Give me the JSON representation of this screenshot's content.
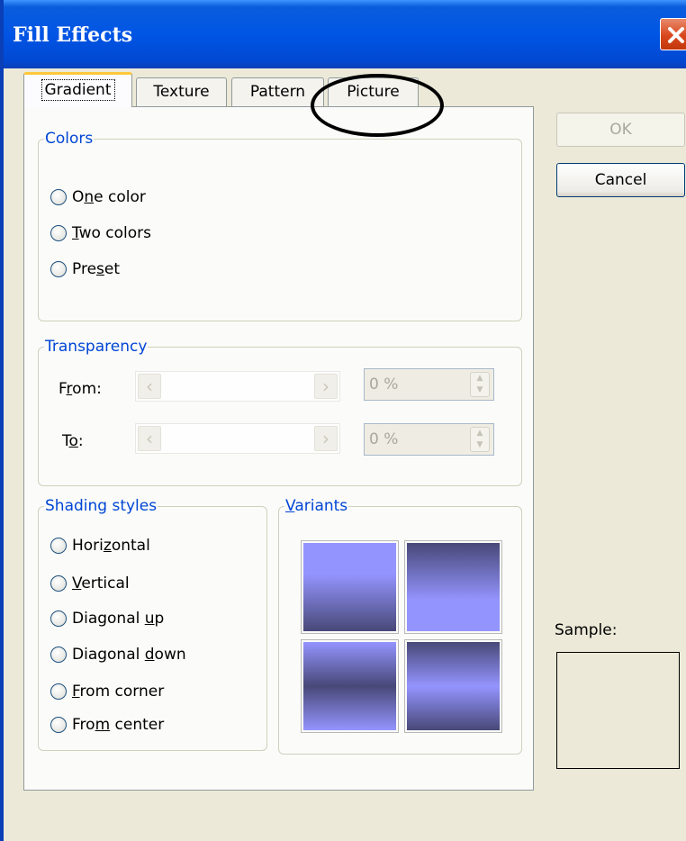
{
  "window": {
    "title": "Fill Effects"
  },
  "tabs": [
    {
      "label": "Gradient",
      "active": true
    },
    {
      "label": "Texture"
    },
    {
      "label": "Pattern"
    },
    {
      "label": "Picture"
    }
  ],
  "colors_group": {
    "label": "Colors",
    "options": [
      {
        "pre": "O",
        "key": "n",
        "post": "e color"
      },
      {
        "pre": "",
        "key": "T",
        "post": "wo colors"
      },
      {
        "pre": "Pre",
        "key": "s",
        "post": "et"
      }
    ]
  },
  "transparency_group": {
    "label": "Transparency",
    "from_label": {
      "pre": "F",
      "key": "r",
      "post": "om:"
    },
    "to_label": {
      "pre": "T",
      "key": "o",
      "post": ":"
    },
    "from_value": "0 %",
    "to_value": "0 %"
  },
  "shading_group": {
    "label": "Shading styles",
    "options": [
      {
        "pre": "Hori",
        "key": "z",
        "post": "ontal"
      },
      {
        "pre": "",
        "key": "V",
        "post": "ertical"
      },
      {
        "pre": "Diagonal ",
        "key": "u",
        "post": "p"
      },
      {
        "pre": "Diagonal ",
        "key": "d",
        "post": "own"
      },
      {
        "pre": "",
        "key": "F",
        "post": "rom corner"
      },
      {
        "pre": "Fro",
        "key": "m",
        "post": " center"
      }
    ]
  },
  "variants_group": {
    "pre": "",
    "key": "V",
    "post": "ariants"
  },
  "buttons": {
    "ok": "OK",
    "cancel": "Cancel"
  },
  "sample_label": "Sample:",
  "colors": {
    "gradient_light": "#9494ff",
    "gradient_dark": "#484878",
    "title_bar": "#0055e5",
    "group_label": "#0046d5"
  }
}
